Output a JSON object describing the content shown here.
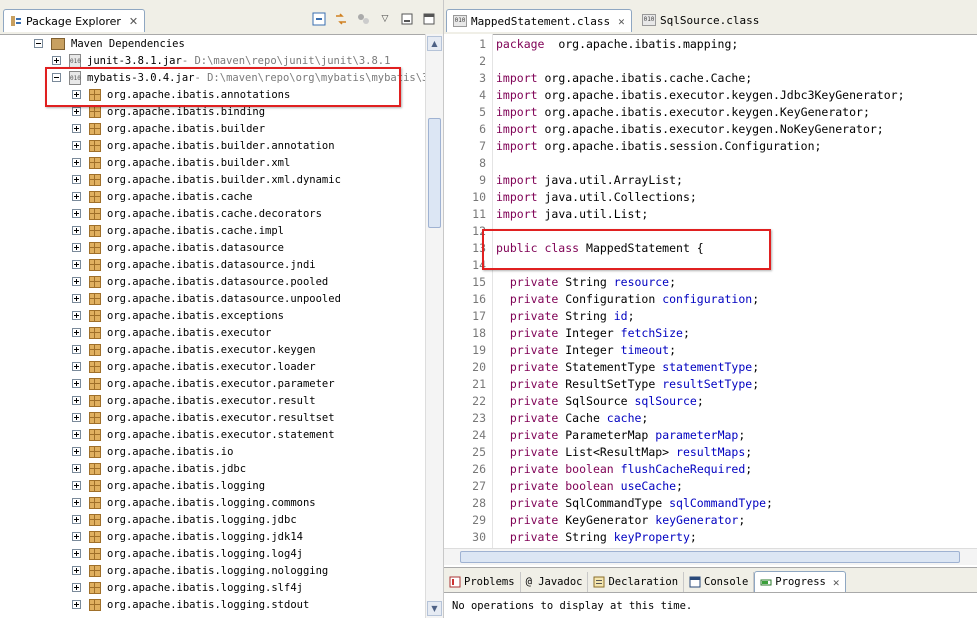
{
  "package_explorer": {
    "title": "Package Explorer",
    "tree": [
      {
        "label": "Maven Dependencies",
        "suffix": "",
        "level": 0,
        "icon": "library-icon",
        "expand": "minus"
      },
      {
        "label": "junit-3.8.1.jar",
        "suffix": " - D:\\maven\\repo\\junit\\junit\\3.8.1",
        "level": 1,
        "icon": "jar-icon",
        "expand": "plus"
      },
      {
        "label": "mybatis-3.0.4.jar",
        "suffix": " - D:\\maven\\repo\\org\\mybatis\\mybatis\\3.",
        "level": 1,
        "icon": "jar-icon",
        "expand": "minus"
      },
      {
        "label": "org.apache.ibatis.annotations",
        "suffix": "",
        "level": 2,
        "icon": "package-icon",
        "expand": "plus"
      },
      {
        "label": "org.apache.ibatis.binding",
        "suffix": "",
        "level": 2,
        "icon": "package-icon",
        "expand": "plus"
      },
      {
        "label": "org.apache.ibatis.builder",
        "suffix": "",
        "level": 2,
        "icon": "package-icon",
        "expand": "plus"
      },
      {
        "label": "org.apache.ibatis.builder.annotation",
        "suffix": "",
        "level": 2,
        "icon": "package-icon",
        "expand": "plus"
      },
      {
        "label": "org.apache.ibatis.builder.xml",
        "suffix": "",
        "level": 2,
        "icon": "package-icon",
        "expand": "plus"
      },
      {
        "label": "org.apache.ibatis.builder.xml.dynamic",
        "suffix": "",
        "level": 2,
        "icon": "package-icon",
        "expand": "plus"
      },
      {
        "label": "org.apache.ibatis.cache",
        "suffix": "",
        "level": 2,
        "icon": "package-icon",
        "expand": "plus"
      },
      {
        "label": "org.apache.ibatis.cache.decorators",
        "suffix": "",
        "level": 2,
        "icon": "package-icon",
        "expand": "plus"
      },
      {
        "label": "org.apache.ibatis.cache.impl",
        "suffix": "",
        "level": 2,
        "icon": "package-icon",
        "expand": "plus"
      },
      {
        "label": "org.apache.ibatis.datasource",
        "suffix": "",
        "level": 2,
        "icon": "package-icon",
        "expand": "plus"
      },
      {
        "label": "org.apache.ibatis.datasource.jndi",
        "suffix": "",
        "level": 2,
        "icon": "package-icon",
        "expand": "plus"
      },
      {
        "label": "org.apache.ibatis.datasource.pooled",
        "suffix": "",
        "level": 2,
        "icon": "package-icon",
        "expand": "plus"
      },
      {
        "label": "org.apache.ibatis.datasource.unpooled",
        "suffix": "",
        "level": 2,
        "icon": "package-icon",
        "expand": "plus"
      },
      {
        "label": "org.apache.ibatis.exceptions",
        "suffix": "",
        "level": 2,
        "icon": "package-icon",
        "expand": "plus"
      },
      {
        "label": "org.apache.ibatis.executor",
        "suffix": "",
        "level": 2,
        "icon": "package-icon",
        "expand": "plus"
      },
      {
        "label": "org.apache.ibatis.executor.keygen",
        "suffix": "",
        "level": 2,
        "icon": "package-icon",
        "expand": "plus"
      },
      {
        "label": "org.apache.ibatis.executor.loader",
        "suffix": "",
        "level": 2,
        "icon": "package-icon",
        "expand": "plus"
      },
      {
        "label": "org.apache.ibatis.executor.parameter",
        "suffix": "",
        "level": 2,
        "icon": "package-icon",
        "expand": "plus"
      },
      {
        "label": "org.apache.ibatis.executor.result",
        "suffix": "",
        "level": 2,
        "icon": "package-icon",
        "expand": "plus"
      },
      {
        "label": "org.apache.ibatis.executor.resultset",
        "suffix": "",
        "level": 2,
        "icon": "package-icon",
        "expand": "plus"
      },
      {
        "label": "org.apache.ibatis.executor.statement",
        "suffix": "",
        "level": 2,
        "icon": "package-icon",
        "expand": "plus"
      },
      {
        "label": "org.apache.ibatis.io",
        "suffix": "",
        "level": 2,
        "icon": "package-icon",
        "expand": "plus"
      },
      {
        "label": "org.apache.ibatis.jdbc",
        "suffix": "",
        "level": 2,
        "icon": "package-icon",
        "expand": "plus"
      },
      {
        "label": "org.apache.ibatis.logging",
        "suffix": "",
        "level": 2,
        "icon": "package-icon",
        "expand": "plus"
      },
      {
        "label": "org.apache.ibatis.logging.commons",
        "suffix": "",
        "level": 2,
        "icon": "package-icon",
        "expand": "plus"
      },
      {
        "label": "org.apache.ibatis.logging.jdbc",
        "suffix": "",
        "level": 2,
        "icon": "package-icon",
        "expand": "plus"
      },
      {
        "label": "org.apache.ibatis.logging.jdk14",
        "suffix": "",
        "level": 2,
        "icon": "package-icon",
        "expand": "plus"
      },
      {
        "label": "org.apache.ibatis.logging.log4j",
        "suffix": "",
        "level": 2,
        "icon": "package-icon",
        "expand": "plus"
      },
      {
        "label": "org.apache.ibatis.logging.nologging",
        "suffix": "",
        "level": 2,
        "icon": "package-icon",
        "expand": "plus"
      },
      {
        "label": "org.apache.ibatis.logging.slf4j",
        "suffix": "",
        "level": 2,
        "icon": "package-icon",
        "expand": "plus"
      },
      {
        "label": "org.apache.ibatis.logging.stdout",
        "suffix": "",
        "level": 2,
        "icon": "package-icon",
        "expand": "plus"
      }
    ]
  },
  "editor": {
    "tabs": [
      {
        "label": "MappedStatement.class",
        "active": true
      },
      {
        "label": "SqlSource.class",
        "active": false
      }
    ],
    "lines": [
      {
        "n": "1",
        "segs": [
          [
            "kw",
            "package"
          ],
          [
            "",
            "  org.apache.ibatis.mapping;"
          ]
        ]
      },
      {
        "n": "2",
        "segs": []
      },
      {
        "n": "3",
        "segs": [
          [
            "kw",
            "import"
          ],
          [
            "",
            " org.apache.ibatis.cache.Cache;"
          ]
        ]
      },
      {
        "n": "4",
        "segs": [
          [
            "kw",
            "import"
          ],
          [
            "",
            " org.apache.ibatis.executor.keygen.Jdbc3KeyGenerator;"
          ]
        ]
      },
      {
        "n": "5",
        "segs": [
          [
            "kw",
            "import"
          ],
          [
            "",
            " org.apache.ibatis.executor.keygen.KeyGenerator;"
          ]
        ]
      },
      {
        "n": "6",
        "segs": [
          [
            "kw",
            "import"
          ],
          [
            "",
            " org.apache.ibatis.executor.keygen.NoKeyGenerator;"
          ]
        ]
      },
      {
        "n": "7",
        "segs": [
          [
            "kw",
            "import"
          ],
          [
            "",
            " org.apache.ibatis.session.Configuration;"
          ]
        ]
      },
      {
        "n": "8",
        "segs": []
      },
      {
        "n": "9",
        "segs": [
          [
            "kw",
            "import"
          ],
          [
            "",
            " java.util.ArrayList;"
          ]
        ]
      },
      {
        "n": "10",
        "segs": [
          [
            "kw",
            "import"
          ],
          [
            "",
            " java.util.Collections;"
          ]
        ]
      },
      {
        "n": "11",
        "segs": [
          [
            "kw",
            "import"
          ],
          [
            "",
            " java.util.List;"
          ]
        ]
      },
      {
        "n": "12",
        "segs": []
      },
      {
        "n": "13",
        "segs": [
          [
            "kw",
            "public class"
          ],
          [
            "",
            " MappedStatement {"
          ]
        ]
      },
      {
        "n": "14",
        "segs": []
      },
      {
        "n": "15",
        "segs": [
          [
            "",
            "  "
          ],
          [
            "kw",
            "private"
          ],
          [
            "",
            " String "
          ],
          [
            "fld",
            "resource"
          ],
          [
            "",
            ";"
          ]
        ]
      },
      {
        "n": "16",
        "segs": [
          [
            "",
            "  "
          ],
          [
            "kw",
            "private"
          ],
          [
            "",
            " Configuration "
          ],
          [
            "fld",
            "configuration"
          ],
          [
            "",
            ";"
          ]
        ]
      },
      {
        "n": "17",
        "segs": [
          [
            "",
            "  "
          ],
          [
            "kw",
            "private"
          ],
          [
            "",
            " String "
          ],
          [
            "fld",
            "id"
          ],
          [
            "",
            ";"
          ]
        ]
      },
      {
        "n": "18",
        "segs": [
          [
            "",
            "  "
          ],
          [
            "kw",
            "private"
          ],
          [
            "",
            " Integer "
          ],
          [
            "fld",
            "fetchSize"
          ],
          [
            "",
            ";"
          ]
        ]
      },
      {
        "n": "19",
        "segs": [
          [
            "",
            "  "
          ],
          [
            "kw",
            "private"
          ],
          [
            "",
            " Integer "
          ],
          [
            "fld",
            "timeout"
          ],
          [
            "",
            ";"
          ]
        ]
      },
      {
        "n": "20",
        "segs": [
          [
            "",
            "  "
          ],
          [
            "kw",
            "private"
          ],
          [
            "",
            " StatementType "
          ],
          [
            "fld",
            "statementType"
          ],
          [
            "",
            ";"
          ]
        ]
      },
      {
        "n": "21",
        "segs": [
          [
            "",
            "  "
          ],
          [
            "kw",
            "private"
          ],
          [
            "",
            " ResultSetType "
          ],
          [
            "fld",
            "resultSetType"
          ],
          [
            "",
            ";"
          ]
        ]
      },
      {
        "n": "22",
        "segs": [
          [
            "",
            "  "
          ],
          [
            "kw",
            "private"
          ],
          [
            "",
            " SqlSource "
          ],
          [
            "fld",
            "sqlSource"
          ],
          [
            "",
            ";"
          ]
        ]
      },
      {
        "n": "23",
        "segs": [
          [
            "",
            "  "
          ],
          [
            "kw",
            "private"
          ],
          [
            "",
            " Cache "
          ],
          [
            "fld",
            "cache"
          ],
          [
            "",
            ";"
          ]
        ]
      },
      {
        "n": "24",
        "segs": [
          [
            "",
            "  "
          ],
          [
            "kw",
            "private"
          ],
          [
            "",
            " ParameterMap "
          ],
          [
            "fld",
            "parameterMap"
          ],
          [
            "",
            ";"
          ]
        ]
      },
      {
        "n": "25",
        "segs": [
          [
            "",
            "  "
          ],
          [
            "kw",
            "private"
          ],
          [
            "",
            " List<ResultMap> "
          ],
          [
            "fld",
            "resultMaps"
          ],
          [
            "",
            ";"
          ]
        ]
      },
      {
        "n": "26",
        "segs": [
          [
            "",
            "  "
          ],
          [
            "kw",
            "private boolean"
          ],
          [
            "",
            " "
          ],
          [
            "fld",
            "flushCacheRequired"
          ],
          [
            "",
            ";"
          ]
        ]
      },
      {
        "n": "27",
        "segs": [
          [
            "",
            "  "
          ],
          [
            "kw",
            "private boolean"
          ],
          [
            "",
            " "
          ],
          [
            "fld",
            "useCache"
          ],
          [
            "",
            ";"
          ]
        ]
      },
      {
        "n": "28",
        "segs": [
          [
            "",
            "  "
          ],
          [
            "kw",
            "private"
          ],
          [
            "",
            " SqlCommandType "
          ],
          [
            "fld",
            "sqlCommandType"
          ],
          [
            "",
            ";"
          ]
        ]
      },
      {
        "n": "29",
        "segs": [
          [
            "",
            "  "
          ],
          [
            "kw",
            "private"
          ],
          [
            "",
            " KeyGenerator "
          ],
          [
            "fld",
            "keyGenerator"
          ],
          [
            "",
            ";"
          ]
        ]
      },
      {
        "n": "30",
        "segs": [
          [
            "",
            "  "
          ],
          [
            "kw",
            "private"
          ],
          [
            "",
            " String "
          ],
          [
            "fld",
            "keyProperty"
          ],
          [
            "",
            ";"
          ]
        ]
      }
    ]
  },
  "bottom": {
    "tabs": [
      {
        "label": "Problems",
        "icon": "problems-icon",
        "active": false
      },
      {
        "label": "@ Javadoc",
        "icon": "javadoc-icon",
        "active": false
      },
      {
        "label": "Declaration",
        "icon": "declaration-icon",
        "active": false
      },
      {
        "label": "Console",
        "icon": "console-icon",
        "active": false
      },
      {
        "label": "Progress",
        "icon": "progress-icon",
        "active": true
      }
    ],
    "message": "No operations to display at this time."
  },
  "colors": {
    "keyword": "#7f0055",
    "field": "#0000c0",
    "highlight_box": "#e02020"
  }
}
